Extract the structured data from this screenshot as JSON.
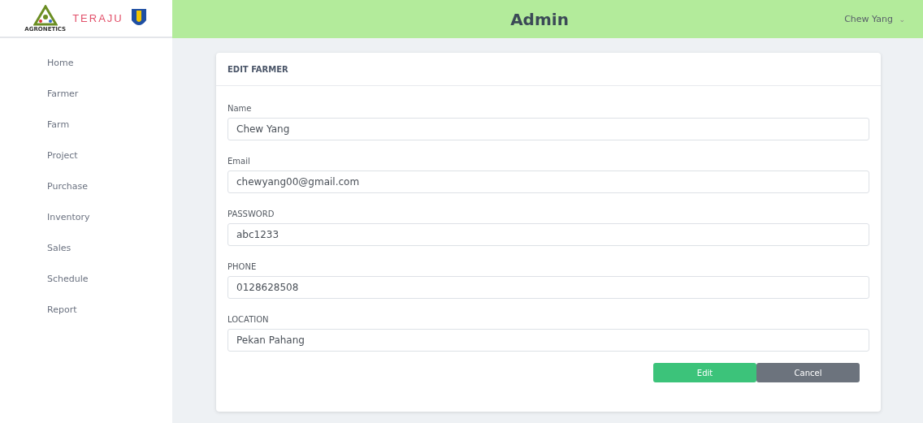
{
  "logos": [
    {
      "text": "AGRONETICS"
    },
    {
      "text": "TERAJU"
    }
  ],
  "header": {
    "title": "Admin",
    "user": "Chew Yang",
    "caret": "⌄"
  },
  "sidebar": {
    "items": [
      "Home",
      "Farmer",
      "Farm",
      "Project",
      "Purchase",
      "Inventory",
      "Sales",
      "Schedule",
      "Report"
    ]
  },
  "card": {
    "title": "EDIT FARMER",
    "fields": [
      {
        "label": "Name",
        "value": "Chew Yang"
      },
      {
        "label": "Email",
        "value": "chewyang00@gmail.com"
      },
      {
        "label": "PASSWORD",
        "value": "abc1233"
      },
      {
        "label": "PHONE",
        "value": "0128628508"
      },
      {
        "label": "LOCATION",
        "value": "Pekan Pahang"
      }
    ],
    "buttons": [
      {
        "label": "Edit",
        "kind": "primary"
      },
      {
        "label": "Cancel",
        "kind": "secondary"
      }
    ]
  }
}
